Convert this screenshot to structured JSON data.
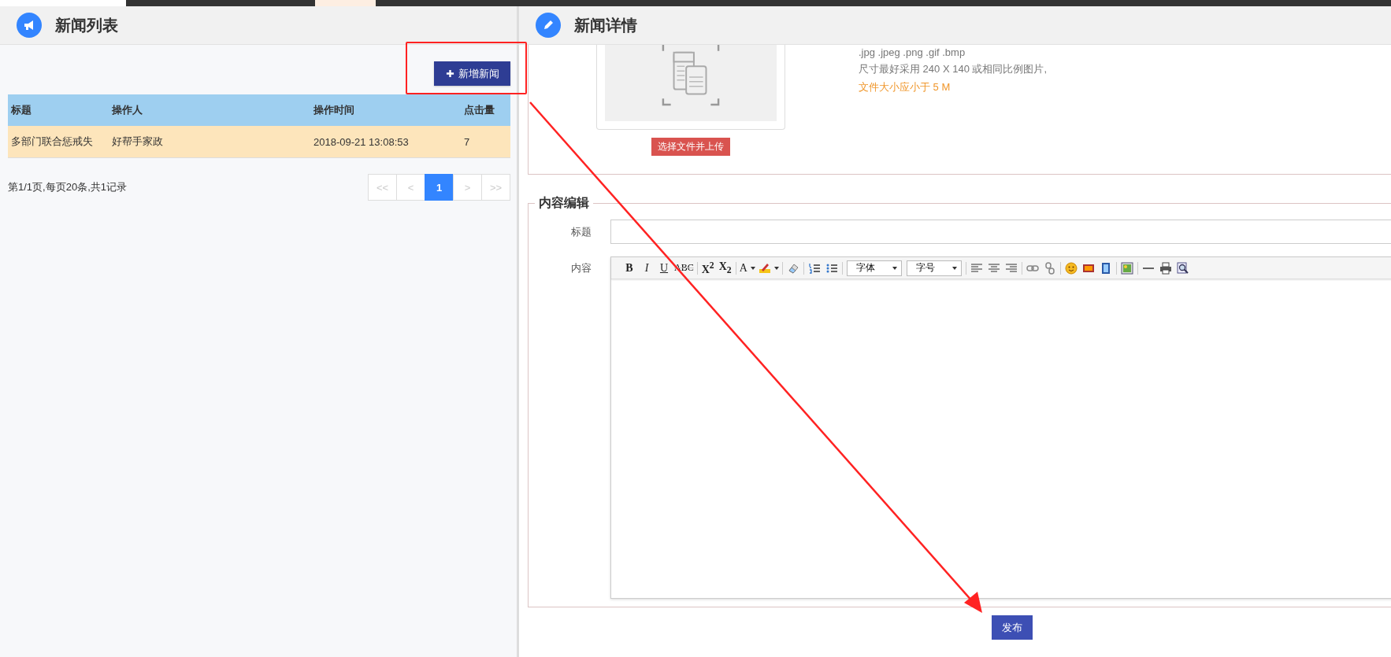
{
  "news_list": {
    "title": "新闻列表",
    "add_button": "新增新闻",
    "columns": [
      "标题",
      "操作人",
      "操作时间",
      "点击量"
    ],
    "rows": [
      {
        "cells": [
          "多部门联合惩戒失",
          "好帮手家政",
          "2018-09-21 13:08:53",
          "7"
        ],
        "selected": true
      }
    ],
    "summary": "第1/1页,每页20条,共1记录",
    "pager": [
      {
        "label": "<<",
        "selected": false,
        "disabled": true
      },
      {
        "label": "<",
        "selected": false,
        "disabled": true
      },
      {
        "label": "1",
        "selected": true,
        "disabled": false
      },
      {
        "label": ">",
        "selected": false,
        "disabled": true
      },
      {
        "label": ">>",
        "selected": false,
        "disabled": true
      }
    ]
  },
  "news_detail": {
    "title": "新闻详情",
    "upload": {
      "button": "选择文件并上传",
      "hints": [
        {
          "text": ".jpg .jpeg .png .gif .bmp",
          "warning": false
        },
        {
          "text": "尺寸最好采用 240 X 140 或相同比例图片,",
          "warning": false
        },
        {
          "text": "文件大小应小于 5 M",
          "warning": true
        }
      ]
    },
    "editor_section": {
      "legend": "内容编辑",
      "title_label": "标题",
      "content_label": "内容",
      "toolbar": [
        {
          "kind": "bold",
          "label": "B"
        },
        {
          "kind": "italic",
          "label": "I"
        },
        {
          "kind": "underline",
          "label": "U"
        },
        {
          "kind": "strike",
          "label": "ABC"
        },
        {
          "kind": "sep"
        },
        {
          "kind": "superscript",
          "label": "X$^{2}$"
        },
        {
          "kind": "subscript",
          "label": "X$_{2}$"
        },
        {
          "kind": "sep"
        },
        {
          "kind": "font-color",
          "label": "A",
          "caret": true
        },
        {
          "kind": "highlight",
          "caret": true
        },
        {
          "kind": "sep"
        },
        {
          "kind": "eraser"
        },
        {
          "kind": "sep"
        },
        {
          "kind": "ordered-list"
        },
        {
          "kind": "bullet-list"
        },
        {
          "kind": "sep"
        },
        {
          "kind": "select",
          "label": "字体"
        },
        {
          "kind": "select",
          "label": "字号"
        },
        {
          "kind": "sep"
        },
        {
          "kind": "align-left"
        },
        {
          "kind": "align-center"
        },
        {
          "kind": "align-right"
        },
        {
          "kind": "sep"
        },
        {
          "kind": "link"
        },
        {
          "kind": "unlink"
        },
        {
          "kind": "sep"
        },
        {
          "kind": "emoticon"
        },
        {
          "kind": "image"
        },
        {
          "kind": "video"
        },
        {
          "kind": "sep"
        },
        {
          "kind": "gallery"
        },
        {
          "kind": "sep"
        },
        {
          "kind": "rule"
        },
        {
          "kind": "print"
        },
        {
          "kind": "preview"
        }
      ]
    },
    "publish_button": "发布"
  }
}
